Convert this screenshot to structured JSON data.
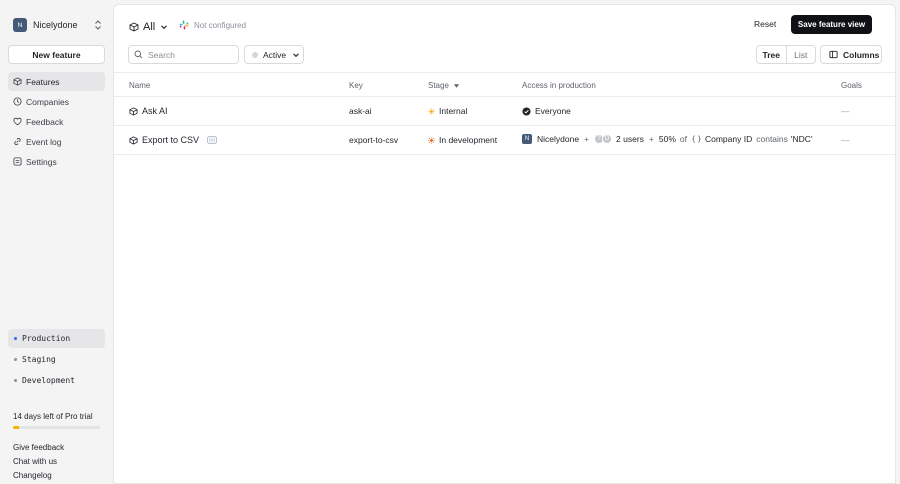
{
  "sidebar": {
    "org": {
      "avatar": "N",
      "name": "Nicelydone"
    },
    "new_feature_label": "New feature",
    "nav": [
      {
        "label": "Features",
        "icon": "feature-icon"
      },
      {
        "label": "Companies",
        "icon": "companies-icon"
      },
      {
        "label": "Feedback",
        "icon": "feedback-icon"
      },
      {
        "label": "Event log",
        "icon": "event-log-icon"
      },
      {
        "label": "Settings",
        "icon": "settings-icon"
      }
    ],
    "environments": [
      {
        "label": "Production",
        "active": true
      },
      {
        "label": "Staging",
        "active": false
      },
      {
        "label": "Development",
        "active": false
      }
    ],
    "trial": {
      "text": "14 days left of Pro trial",
      "progress": 0.07,
      "color": "#f2b600"
    },
    "footer_links": [
      "Give feedback",
      "Chat with us",
      "Changelog"
    ]
  },
  "toolbar": {
    "view": "All",
    "integration_status": "Not configured",
    "reset_label": "Reset",
    "save_view_label": "Save feature view",
    "search_placeholder": "Search",
    "status_filter": "Active",
    "tree_label": "Tree",
    "list_label": "List",
    "columns_label": "Columns"
  },
  "table": {
    "headers": {
      "name": "Name",
      "key": "Key",
      "stage": "Stage",
      "access": "Access in production",
      "goals": "Goals"
    },
    "rows": [
      {
        "name": "Ask AI",
        "key": "ask-ai",
        "stage": "Internal",
        "stage_color": "#f59f00",
        "access": {
          "label": "Everyone"
        },
        "goals": "—"
      },
      {
        "name": "Export to CSV",
        "key": "export-to-csv",
        "stage": "In development",
        "stage_color": "#e8590c",
        "access": {
          "company_avatar": "N",
          "company": "Nicelydone",
          "plus_1": "+",
          "user_avatars": [
            "?",
            "D"
          ],
          "users": "2 users",
          "plus_2": "+",
          "percent": "50%",
          "of": "of",
          "attribute": "Company ID",
          "operator": "contains",
          "value": "'NDC'"
        },
        "goals": "—"
      }
    ]
  }
}
